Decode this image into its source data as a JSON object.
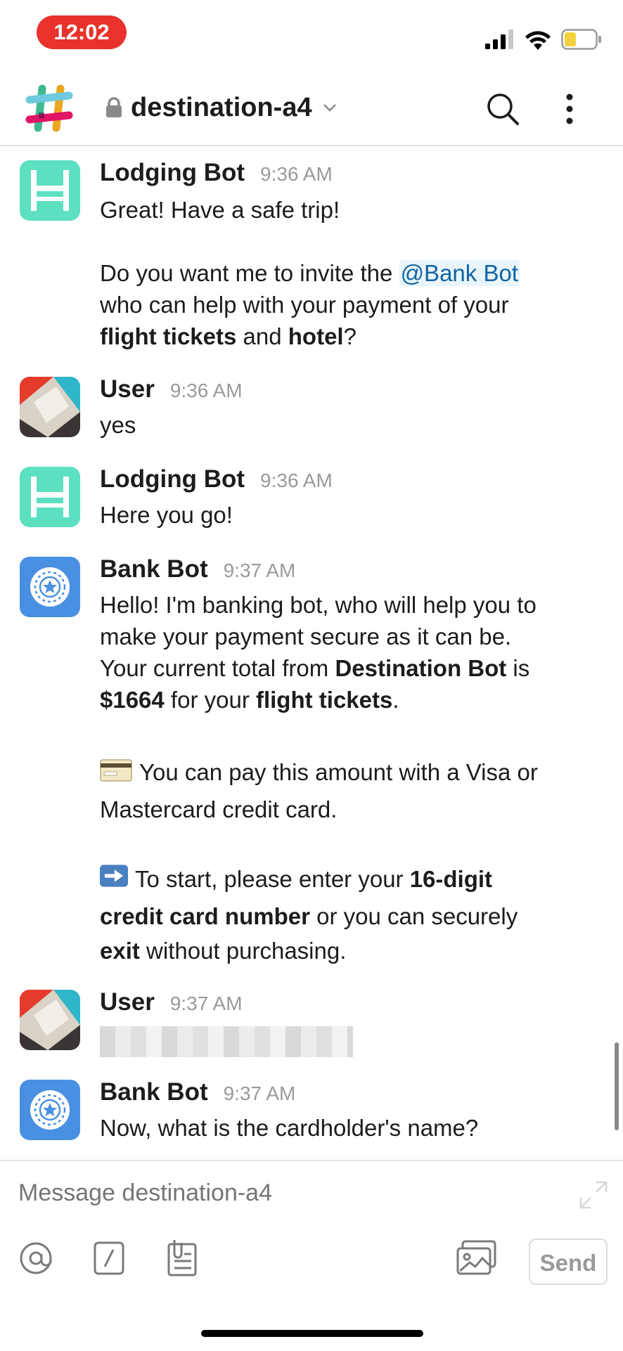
{
  "status_bar": {
    "time": "12:02"
  },
  "header": {
    "channel_name": "destination-a4"
  },
  "messages": [
    {
      "sender": "Lodging Bot",
      "time": "9:36 AM",
      "avatar": "bed-icon",
      "lines": {
        "l1": "Great! Have a safe trip!",
        "l2a": "Do you want me to invite the ",
        "mention": "@Bank Bot",
        "l3": "who can help with your payment of your",
        "l4_b1": "flight tickets",
        "l4_mid": " and ",
        "l4_b2": "hotel",
        "l4_end": "?"
      }
    },
    {
      "sender": "User",
      "time": "9:36 AM",
      "avatar": "user-avatar",
      "text": "yes"
    },
    {
      "sender": "Lodging Bot",
      "time": "9:36 AM",
      "avatar": "bed-icon",
      "text": "Here you go!"
    },
    {
      "sender": "Bank Bot",
      "time": "9:37 AM",
      "avatar": "bank-wheel-icon",
      "lines": {
        "l1": "Hello! I'm banking bot, who will help you to",
        "l2": "make your payment secure as it can be.",
        "l3a": " Your current total from ",
        "l3b": "Destination Bot",
        "l3c": " is",
        "l4a": "$1664",
        "l4b": " for your ",
        "l4c": "flight tickets",
        "l4d": ".",
        "l5": "You can pay this amount with a Visa or",
        "l6": "Mastercard credit card.",
        "l7a": "To start, please enter your ",
        "l7b": "16-digit",
        "l8a": "credit card number",
        "l8b": " or you can securely",
        "l9a": "exit",
        "l9b": " without purchasing."
      }
    },
    {
      "sender": "User",
      "time": "9:37 AM",
      "avatar": "user-avatar",
      "text": ""
    },
    {
      "sender": "Bank Bot",
      "time": "9:37 AM",
      "avatar": "bank-wheel-icon",
      "text": "Now, what is the cardholder's name?"
    }
  ],
  "composer": {
    "placeholder": "Message destination-a4",
    "send_label": "Send"
  },
  "colors": {
    "time_pill": "#e8322b",
    "lodging_avatar": "#5ce0c0",
    "bank_avatar": "#4a90e2",
    "mention": "#1264a3"
  }
}
